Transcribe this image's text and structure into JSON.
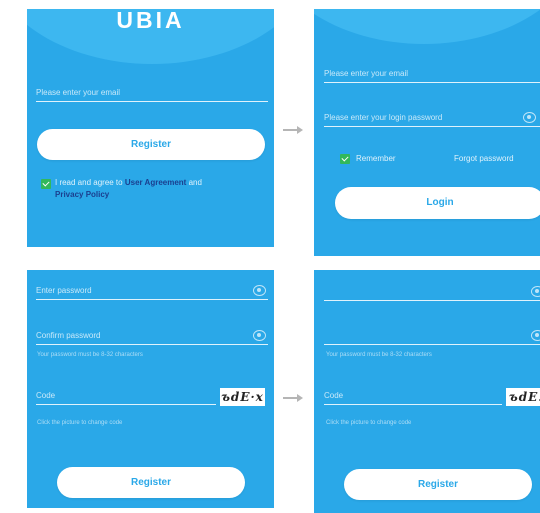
{
  "colors": {
    "screen_bg": "#2aa8e8",
    "dome": "#3db7f0",
    "button_bg": "#ffffff",
    "button_text": "#2aa8e8",
    "checkbox": "#32b85a",
    "link": "#1b3f8f",
    "arrow": "#b5b5b5"
  },
  "register_email_screen": {
    "logo": "UBIA",
    "email_placeholder": "Please enter your email",
    "register_button": "Register",
    "agree_prefix": "I read and agree to",
    "user_agreement": "User Agreement",
    "and": "and",
    "privacy_policy": "Privacy Policy"
  },
  "login_screen": {
    "email_placeholder": "Please enter your email",
    "password_placeholder": "Please enter your login password",
    "remember": "Remember",
    "forgot": "Forgot password",
    "login_button": "Login"
  },
  "password_screen_a": {
    "password_placeholder": "Enter password",
    "confirm_placeholder": "Confirm password",
    "hint": "Your password must be 8-32 characters",
    "code_placeholder": "Code",
    "captcha_text": "ъdЕ·x",
    "captcha_hint": "Click the picture to change code",
    "register_button": "Register"
  },
  "password_screen_b": {
    "hint": "Your password must be 8-32 characters",
    "code_placeholder": "Code",
    "captcha_text": "ъdЕ.",
    "captcha_hint": "Click the picture to change code",
    "register_button": "Register"
  },
  "icons": {
    "arrow": "arrow-right-icon",
    "eye": "eye-icon",
    "check": "checkbox-checked-icon"
  }
}
